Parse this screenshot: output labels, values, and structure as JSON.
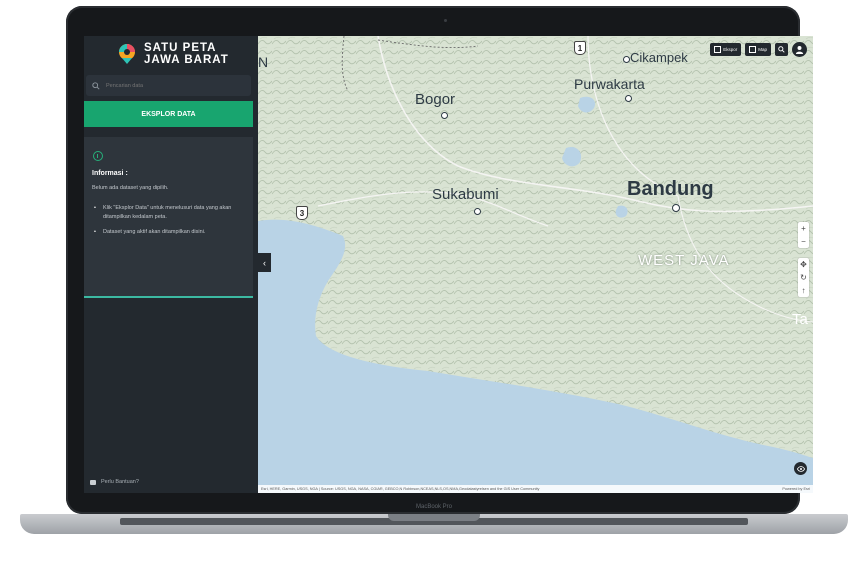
{
  "device": {
    "label": "MacBook Pro"
  },
  "sidebar": {
    "brand_line1": "SATU PETA",
    "brand_line2": "JAWA BARAT",
    "search_placeholder": "Pencarian data",
    "explore_button": "EKSPLOR DATA",
    "info": {
      "title": "Informasi :",
      "description": "Belum ada dataset yang dipilih.",
      "items": [
        "Klik \"Eksplor Data\" untuk menelusuri data yang akan ditampilkan kedalam peta.",
        "Dataset yang aktif akan ditampilkan disini."
      ]
    },
    "help_label": "Perlu Bantuan?",
    "collapse_icon": "chevron-left-icon"
  },
  "toolbar": {
    "export_label": "Ekspor",
    "map_label": "Map"
  },
  "map": {
    "labels": {
      "cikampek": "Cikampek",
      "purwakarta": "Purwakarta",
      "bogor": "Bogor",
      "sukabumi": "Sukabumi",
      "bandung": "Bandung",
      "west_java": "WEST JAVA",
      "edge_n": "N",
      "edge_ta": "Ta"
    },
    "road_shields": [
      "1",
      "3"
    ],
    "attribution": "Esri, HERE, Garmin, USGS, NGA | Source: USGS, NGA, NASA, CGIAR, GEBCO,N Robinson,NCEAS,NLS,OS,NMA,Geodatastyrelsen and the GIS User Community",
    "powered_by": "Powered by Esri"
  },
  "colors": {
    "sidebar_bg": "#23292f",
    "accent_green": "#18a56f",
    "sea": "#b9d3e6",
    "land": "#dfe6d9"
  }
}
